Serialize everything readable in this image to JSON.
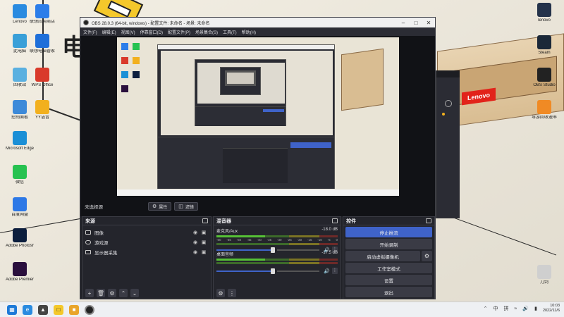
{
  "desktop": {
    "left_icons": [
      {
        "label": "Lenovo",
        "icon": "lenovo-icon",
        "color": "#2a8be0"
      },
      {
        "label": "联想应用商店",
        "icon": "app-store-icon",
        "color": "#2b7de9"
      },
      {
        "label": "此电脑",
        "icon": "computer-icon",
        "color": "#3aa0d8"
      },
      {
        "label": "联想电脑管家",
        "icon": "pc-manager-icon",
        "color": "#1e6fd9"
      },
      {
        "label": "回收站",
        "icon": "recycle-bin-icon",
        "color": "#5ab0e0"
      },
      {
        "label": "WPS Office",
        "icon": "wps-icon",
        "color": "#d93a2b"
      },
      {
        "label": "控制面板",
        "icon": "control-panel-icon",
        "color": "#3d8ad9"
      },
      {
        "label": "YY语音",
        "icon": "yy-icon",
        "color": "#f2b01e"
      },
      {
        "label": "Microsoft Edge",
        "icon": "edge-icon",
        "color": "#1b8fd6"
      },
      {
        "label": "微信",
        "icon": "wechat-icon",
        "color": "#27c250"
      },
      {
        "label": "百度网盘",
        "icon": "cloud-disk-icon",
        "color": "#2d78e6"
      },
      {
        "label": "Adobe Photosho...",
        "icon": "photoshop-icon",
        "color": "#0c1e3d"
      },
      {
        "label": "Adobe Premiere Pr...",
        "icon": "premiere-icon",
        "color": "#2a0f3d"
      }
    ],
    "right_icons": [
      {
        "label": "lenovo",
        "icon": "lenovo-store-icon",
        "color": "#24324a"
      },
      {
        "label": "Steam",
        "icon": "steam-icon",
        "color": "#1b2838"
      },
      {
        "label": "OBS Studio",
        "icon": "obs-icon",
        "color": "#222222"
      },
      {
        "label": "导游回收速率",
        "icon": "orange-app-icon",
        "color": "#f08a24"
      },
      {
        "label": "刀剑",
        "icon": "sword-game-icon",
        "color": "#cfcfcf"
      }
    ]
  },
  "obs": {
    "title": "OBS 28.0.3 (64-bit, windows) - 配置文件: 未命名 - 场景: 未命名",
    "menu": [
      "文件(F)",
      "编辑(E)",
      "视图(V)",
      "停靠窗口(D)",
      "配置文件(P)",
      "场景集合(S)",
      "工具(T)",
      "帮助(H)"
    ],
    "status": {
      "no_source": "未选择源",
      "properties": "属性",
      "filters": "滤镜"
    },
    "sources": {
      "title": "来源",
      "items": [
        {
          "name": "图像",
          "icon": "image-source-icon"
        },
        {
          "name": "游戏源",
          "icon": "game-source-icon"
        },
        {
          "name": "显示器采集",
          "icon": "monitor-source-icon"
        }
      ]
    },
    "mixer": {
      "title": "混音器",
      "scale": [
        "-60",
        "-55",
        "-50",
        "-45",
        "-40",
        "-35",
        "-30",
        "-25",
        "-20",
        "-15",
        "-10",
        "-5",
        "0"
      ],
      "channels": [
        {
          "name": "麦克风/Aux",
          "db": "-18.0 dB",
          "level": 0.4
        },
        {
          "name": "桌面音频",
          "db": "-17.5 dB",
          "level": 0.4
        }
      ]
    },
    "controls": {
      "title": "控件",
      "stop_streaming": "停止推流",
      "start_recording": "开始录制",
      "start_virtual_camera": "启动虚拟摄像机",
      "studio_mode": "工作室模式",
      "settings": "设置",
      "exit": "退出"
    }
  },
  "taskbar": {
    "ime": "中",
    "ime_mode": "拼",
    "time": "10:03",
    "date": "2022/11/6"
  }
}
